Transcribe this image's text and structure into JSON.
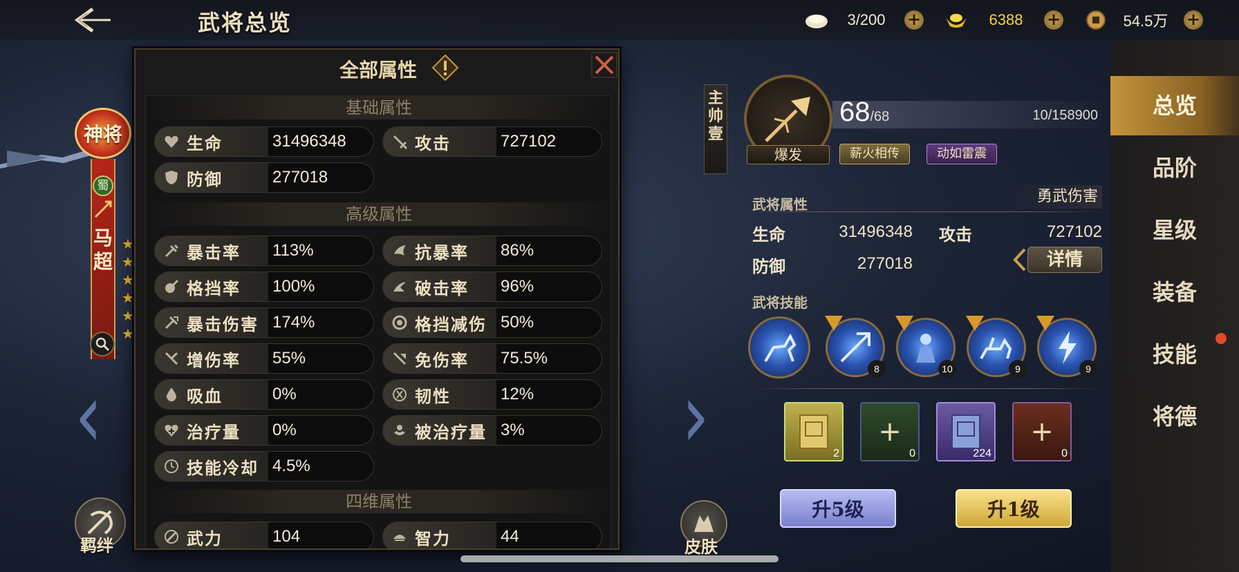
{
  "header": {
    "title": "武将总览",
    "resources": [
      {
        "icon": "bun-icon",
        "value": "3/200"
      },
      {
        "icon": "gold-ingot-icon",
        "value": "6388"
      },
      {
        "icon": "coin-icon",
        "value": "54.5万"
      }
    ]
  },
  "hero": {
    "rank_badge": "神将",
    "faction": "蜀",
    "name": "马超",
    "star_count": 6
  },
  "left_buttons": {
    "bond_label": "羁绊",
    "skin_label": "皮肤"
  },
  "modal": {
    "title": "全部属性",
    "sections": [
      {
        "title": "基础属性",
        "stats": [
          {
            "name": "生命",
            "value": "31496348",
            "icon": "heart-icon"
          },
          {
            "name": "攻击",
            "value": "727102",
            "icon": "sword-icon"
          },
          {
            "name": "防御",
            "value": "277018",
            "icon": "shield-icon"
          }
        ]
      },
      {
        "title": "高级属性",
        "stats": [
          {
            "name": "暴击率",
            "value": "113%",
            "icon": "crit-icon"
          },
          {
            "name": "抗暴率",
            "value": "86%",
            "icon": "anti-crit-icon"
          },
          {
            "name": "格挡率",
            "value": "100%",
            "icon": "block-icon"
          },
          {
            "name": "破击率",
            "value": "96%",
            "icon": "pierce-icon"
          },
          {
            "name": "暴击伤害",
            "value": "174%",
            "icon": "crit-damage-icon"
          },
          {
            "name": "格挡减伤",
            "value": "50%",
            "icon": "block-reduce-icon"
          },
          {
            "name": "增伤率",
            "value": "55%",
            "icon": "damage-up-icon"
          },
          {
            "name": "免伤率",
            "value": "75.5%",
            "icon": "damage-reduce-icon"
          },
          {
            "name": "吸血",
            "value": "0%",
            "icon": "blood-drop-icon"
          },
          {
            "name": "韧性",
            "value": "12%",
            "icon": "toughness-icon"
          },
          {
            "name": "治疗量",
            "value": "0%",
            "icon": "heal-icon"
          },
          {
            "name": "被治疗量",
            "value": "3%",
            "icon": "healed-icon"
          },
          {
            "name": "技能冷却",
            "value": "4.5%",
            "icon": "cooldown-icon"
          }
        ]
      },
      {
        "title": "四维属性",
        "stats": [
          {
            "name": "武力",
            "value": "104",
            "icon": "might-icon"
          },
          {
            "name": "智力",
            "value": "44",
            "icon": "intellect-icon"
          }
        ]
      }
    ]
  },
  "panel": {
    "commander_tag": "主帅壹",
    "type_tag": "爆发",
    "level_current": "68",
    "level_max": "/68",
    "exp": "10/158900",
    "talents": [
      "薪火相传",
      "动如雷震"
    ],
    "attr_section": "武将属性",
    "attr_sub": "勇武伤害",
    "attrs": [
      {
        "name": "生命",
        "value": "31496348"
      },
      {
        "name": "攻击",
        "value": "727102"
      },
      {
        "name": "防御",
        "value": "277018"
      }
    ],
    "detail_label": "详情",
    "skills_section": "武将技能",
    "skills": [
      {
        "level": ""
      },
      {
        "level": "8"
      },
      {
        "level": "10"
      },
      {
        "level": "9"
      },
      {
        "level": "9"
      }
    ],
    "books": [
      {
        "count": "2",
        "color": "#b89a3a"
      },
      {
        "count": "0",
        "color": "#3a5a34"
      },
      {
        "count": "224",
        "color": "#6a5a9a"
      },
      {
        "count": "0",
        "color": "#7a3a24"
      }
    ],
    "up5_label": "升5级",
    "up1_label": "升1级"
  },
  "side_menu": [
    "总览",
    "品阶",
    "星级",
    "装备",
    "技能",
    "将德"
  ]
}
